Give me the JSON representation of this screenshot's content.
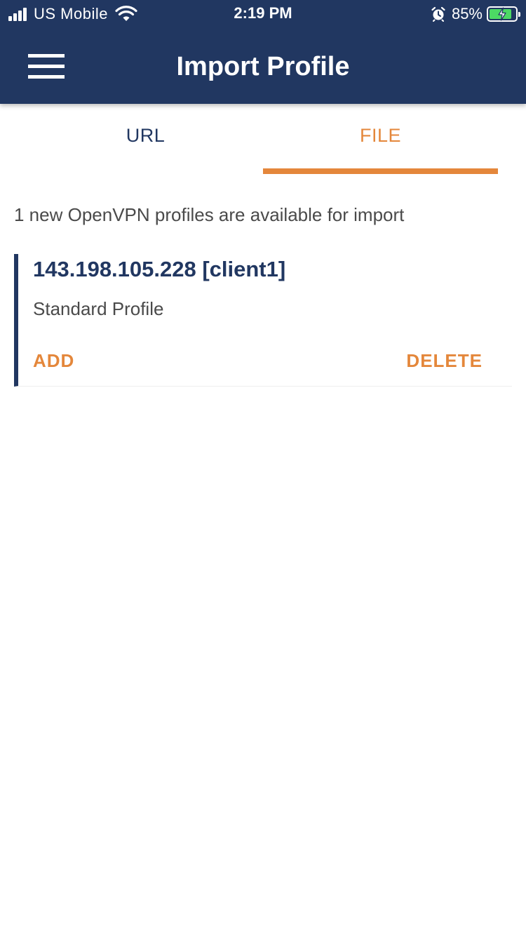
{
  "status_bar": {
    "carrier": "US  Mobile",
    "time": "2:19 PM",
    "battery_percent": "85%",
    "battery_level": 0.85,
    "icons": [
      "signal-icon",
      "wifi-icon",
      "alarm-icon",
      "battery-charging-icon"
    ]
  },
  "header": {
    "title": "Import Profile",
    "menu_icon": "hamburger-menu-icon"
  },
  "tabs": [
    {
      "label": "URL",
      "active": false
    },
    {
      "label": "FILE",
      "active": true
    }
  ],
  "main": {
    "info": "1 new OpenVPN profiles are available for import",
    "profiles": [
      {
        "name": "143.198.105.228 [client1]",
        "type": "Standard Profile",
        "add_label": "ADD",
        "delete_label": "DELETE"
      }
    ]
  },
  "colors": {
    "header_bg": "#213761",
    "accent": "#e4873b",
    "text_primary": "#213761",
    "text_secondary": "#4a4a4a",
    "battery_fill": "#4cd964"
  }
}
